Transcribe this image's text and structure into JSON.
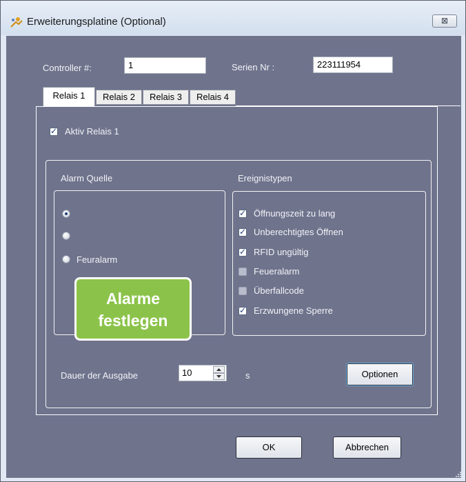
{
  "window": {
    "title": "Erweiterungsplatine (Optional)",
    "close_glyph": "⊠"
  },
  "controller": {
    "label": "Controller #:",
    "value": "1"
  },
  "serial": {
    "label": "Serien Nr :",
    "value": "223111954"
  },
  "tabs": [
    {
      "label": "Relais  1",
      "active": true
    },
    {
      "label": "Relais 2",
      "active": false
    },
    {
      "label": "Relais 3",
      "active": false
    },
    {
      "label": "Relais 4",
      "active": false
    }
  ],
  "aktiv": {
    "label": "Aktiv Relais  1",
    "checked": true
  },
  "alarm_source": {
    "title": "Alarm Quelle",
    "options": [
      {
        "label": "",
        "selected": true
      },
      {
        "label": "",
        "selected": false
      },
      {
        "label": "Feuralarm",
        "selected": false
      }
    ]
  },
  "event_types": {
    "title": "Ereignistypen",
    "items": [
      {
        "label": "Öffnungszeit zu lang",
        "checked": true
      },
      {
        "label": "Unberechtigtes Öffnen",
        "checked": true
      },
      {
        "label": "RFID ungültig",
        "checked": true
      },
      {
        "label": "Feueralarm",
        "checked": false
      },
      {
        "label": "Überfallcode",
        "checked": false
      },
      {
        "label": "Erzwungene Sperre",
        "checked": true
      }
    ]
  },
  "duration": {
    "label": "Dauer der Ausgabe",
    "value": "10",
    "unit": "s"
  },
  "buttons": {
    "options": "Optionen",
    "ok": "OK",
    "cancel": "Abbrechen"
  },
  "overlay": {
    "line1": "Alarme",
    "line2": "festlegen"
  },
  "colors": {
    "client_bg": "#6f738c",
    "overlay_bg": "#8bc34a",
    "check": "#1f3f7a"
  }
}
